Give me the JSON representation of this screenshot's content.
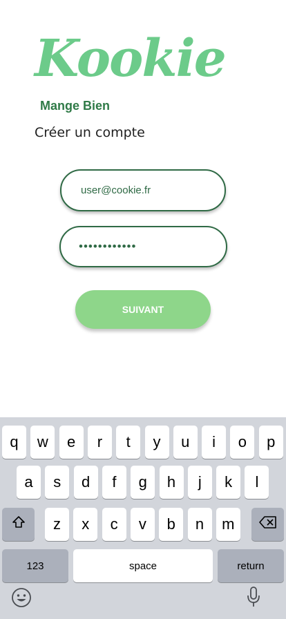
{
  "app": {
    "brand": "Kookie",
    "tagline": "Mange Bien",
    "page_title": "Créer un compte"
  },
  "form": {
    "email_value": "user@cookie.fr",
    "password_value": "••••••••••••",
    "submit_label": "SUIVANT"
  },
  "keyboard": {
    "row1": [
      "q",
      "w",
      "e",
      "r",
      "t",
      "y",
      "u",
      "i",
      "o",
      "p"
    ],
    "row2": [
      "a",
      "s",
      "d",
      "f",
      "g",
      "h",
      "j",
      "k",
      "l"
    ],
    "row3": [
      "z",
      "x",
      "c",
      "v",
      "b",
      "n",
      "m"
    ],
    "numbers_label": "123",
    "space_label": "space",
    "return_label": "return",
    "icons": {
      "shift": "shift-icon",
      "delete": "backspace-icon",
      "emoji": "emoji-icon",
      "mic": "microphone-icon"
    }
  },
  "colors": {
    "brand_green": "#6ccb8a",
    "tagline_green": "#2f7a47",
    "field_border": "#2f6a45",
    "button_green": "#8ed68a",
    "keyboard_bg": "#d2d5db"
  }
}
